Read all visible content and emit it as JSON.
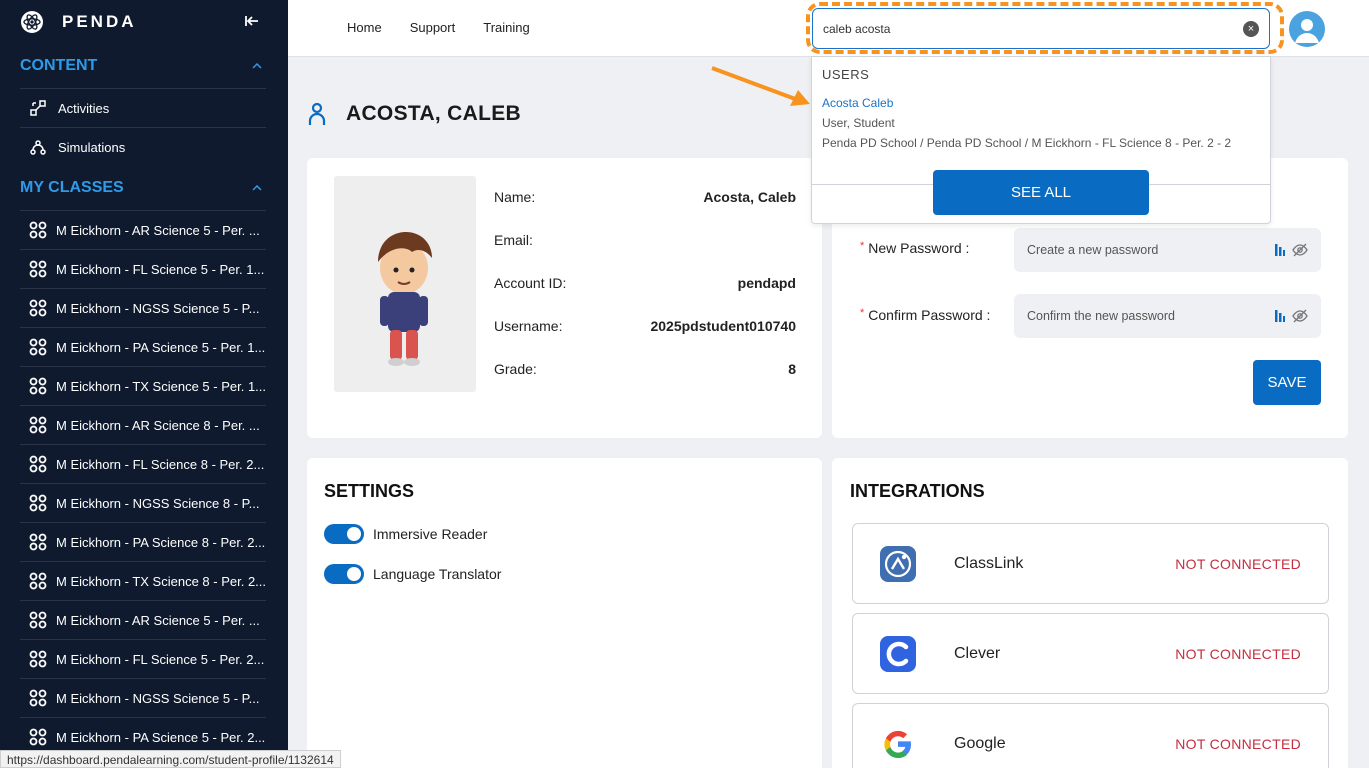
{
  "sidebar": {
    "brand": "PENDA",
    "content_section": "CONTENT",
    "content_items": [
      {
        "label": "Activities",
        "icon": "activities-icon"
      },
      {
        "label": "Simulations",
        "icon": "simulations-icon"
      }
    ],
    "classes_section": "MY CLASSES",
    "classes": [
      "M Eickhorn - AR Science 5 - Per. ...",
      "M Eickhorn - FL Science 5 - Per. 1...",
      "M Eickhorn - NGSS Science 5 - P...",
      "M Eickhorn - PA Science 5 - Per. 1...",
      "M Eickhorn - TX Science 5 - Per. 1...",
      "M Eickhorn - AR Science 8 - Per. ...",
      "M Eickhorn - FL Science 8 - Per. 2...",
      "M Eickhorn - NGSS Science 8 - P...",
      "M Eickhorn - PA Science 8 - Per. 2...",
      "M Eickhorn - TX Science 8 - Per. 2...",
      "M Eickhorn - AR Science 5 - Per. ...",
      "M Eickhorn - FL Science 5 - Per. 2...",
      "M Eickhorn - NGSS Science 5 - P...",
      "M Eickhorn - PA Science 5 - Per. 2..."
    ]
  },
  "status_url": "https://dashboard.pendalearning.com/student-profile/1132614",
  "topnav": {
    "home": "Home",
    "support": "Support",
    "training": "Training"
  },
  "search": {
    "value": "caleb acosta",
    "dropdown": {
      "section": "USERS",
      "result": {
        "name": "Acosta Caleb",
        "role": "User, Student",
        "path": "Penda PD School / Penda PD School / M Eickhorn - FL Science 8 - Per. 2 - 2"
      },
      "see_all": "SEE ALL"
    }
  },
  "profile": {
    "title": "ACOSTA, CALEB",
    "fields": [
      {
        "label": "Name:",
        "value": "Acosta, Caleb"
      },
      {
        "label": "Email:",
        "value": ""
      },
      {
        "label": "Account ID:",
        "value": "pendapd"
      },
      {
        "label": "Username:",
        "value": "2025pdstudent010740"
      },
      {
        "label": "Grade:",
        "value": "8"
      }
    ]
  },
  "password": {
    "new_label": "New Password",
    "new_placeholder": "Create a new password",
    "confirm_label": "Confirm Password",
    "confirm_placeholder": "Confirm the new password",
    "required_mark": "*",
    "save": "SAVE"
  },
  "settings": {
    "title": "SETTINGS",
    "toggles": [
      {
        "label": "Immersive Reader",
        "on": true
      },
      {
        "label": "Language Translator",
        "on": true
      }
    ]
  },
  "integrations": {
    "title": "INTEGRATIONS",
    "items": [
      {
        "name": "ClassLink",
        "status": "NOT CONNECTED",
        "icon": "classlink-logo"
      },
      {
        "name": "Clever",
        "status": "NOT CONNECTED",
        "icon": "clever-logo"
      },
      {
        "name": "Google",
        "status": "NOT CONNECTED",
        "icon": "google-logo"
      }
    ]
  },
  "colors": {
    "sidebar_bg": "#0f1a2e",
    "accent": "#0a6bc2",
    "section_blue": "#2f9be8",
    "highlight_orange": "#f7931e",
    "status_red": "#c62d3f"
  }
}
